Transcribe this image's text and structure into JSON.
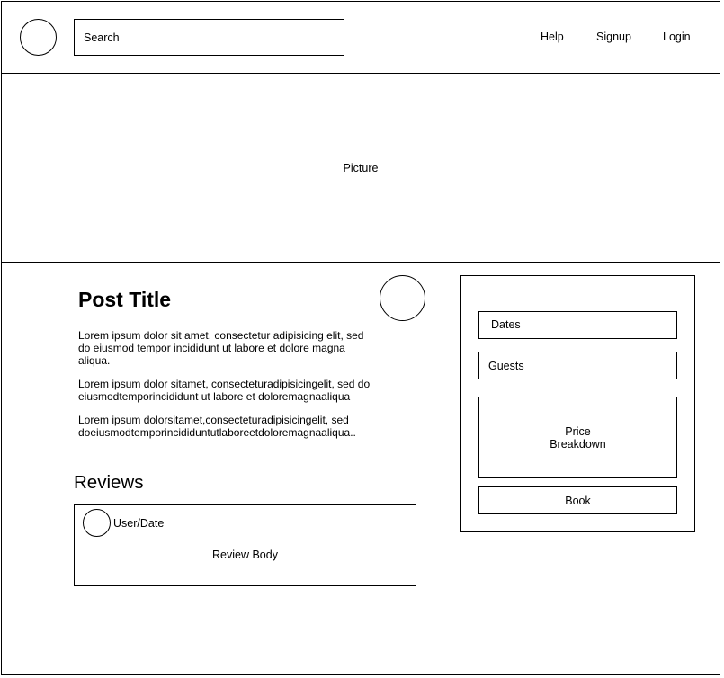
{
  "header": {
    "search": {
      "placeholder": "Search"
    },
    "nav": [
      {
        "label": "Help"
      },
      {
        "label": "Signup"
      },
      {
        "label": "Login"
      }
    ]
  },
  "hero": {
    "label": "Picture"
  },
  "post": {
    "title": "Post Title",
    "paragraphs": [
      "Lorem ipsum dolor sit amet, consectetur adipisicing elit, sed do eiusmod tempor incididunt ut labore et dolore magna aliqua.",
      "Lorem ipsum dolor sitamet, consecteturadipisicingelit, sed do eiusmodtemporincididunt ut labore et doloremagnaaliqua",
      "Lorem ipsum dolorsitamet,consecteturadipisicingelit, sed doeiusmodtemporincididuntutlaboreetdoloremagnaaliqua.."
    ]
  },
  "reviews": {
    "heading": "Reviews",
    "items": [
      {
        "user_date": "User/Date",
        "body": "Review Body"
      }
    ]
  },
  "booking": {
    "dates_label": "Dates",
    "guests_label": "Guests",
    "price_line1": "Price",
    "price_line2": "Breakdown",
    "book_label": "Book"
  }
}
